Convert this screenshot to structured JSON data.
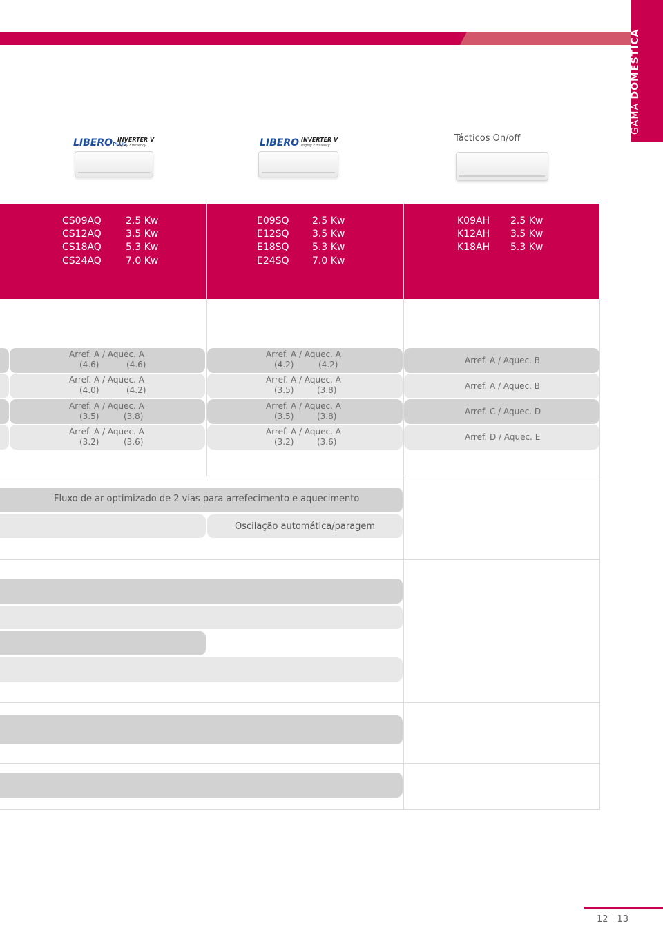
{
  "side_tab": {
    "prefix": "GAMA",
    "bold": "DOMÉSTICA"
  },
  "columns": [
    {
      "logo_brand": "LIBERO",
      "logo_plus": "PLUS",
      "logo_inverter": "INVERTER V",
      "logo_tagline": "Highly Efficiency",
      "models": [
        {
          "model": "CS09AQ",
          "power": "2.5 Kw"
        },
        {
          "model": "CS12AQ",
          "power": "3.5 Kw"
        },
        {
          "model": "CS18AQ",
          "power": "5.3 Kw"
        },
        {
          "model": "CS24AQ",
          "power": "7.0 Kw"
        }
      ],
      "energy": [
        {
          "line1": "Arref. A / Aquec. A",
          "line2a": "(4.6)",
          "line2b": "(4.6)"
        },
        {
          "line1": "Arref. A / Aquec. A",
          "line2a": "(4.0)",
          "line2b": "(4.2)"
        },
        {
          "line1": "Arref. A / Aquec. A",
          "line2a": "(3.5)",
          "line2b": "(3.8)"
        },
        {
          "line1": "Arref. A / Aquec. A",
          "line2a": "(3.2)",
          "line2b": "(3.6)"
        }
      ]
    },
    {
      "logo_brand": "LIBERO",
      "logo_inverter": "INVERTER V",
      "logo_tagline": "Highly Efficiency",
      "models": [
        {
          "model": "E09SQ",
          "power": "2.5 Kw"
        },
        {
          "model": "E12SQ",
          "power": "3.5 Kw"
        },
        {
          "model": "E18SQ",
          "power": "5.3 Kw"
        },
        {
          "model": "E24SQ",
          "power": "7.0 Kw"
        }
      ],
      "energy": [
        {
          "line1": "Arref. A / Aquec. A",
          "line2a": "(4.2)",
          "line2b": "(4.2)"
        },
        {
          "line1": "Arref. A / Aquec. A",
          "line2a": "(3.5)",
          "line2b": "(3.8)"
        },
        {
          "line1": "Arref. A / Aquec. A",
          "line2a": "(3.5)",
          "line2b": "(3.8)"
        },
        {
          "line1": "Arref. A / Aquec. A",
          "line2a": "(3.2)",
          "line2b": "(3.6)"
        }
      ]
    },
    {
      "title": "Tácticos On/off",
      "models": [
        {
          "model": "K09AH",
          "power": "2.5 Kw"
        },
        {
          "model": "K12AH",
          "power": "3.5 Kw"
        },
        {
          "model": "K18AH",
          "power": "5.3 Kw"
        }
      ],
      "energy": [
        {
          "line1": "Arref. A / Aquec. B"
        },
        {
          "line1": "Arref. A / Aquec. B"
        },
        {
          "line1": "Arref. C / Aquec. D"
        },
        {
          "line1": "Arref. D / Aquec. E"
        }
      ]
    }
  ],
  "features": {
    "airflow": "Fluxo de ar optimizado de 2 vias para arrefecimento e aquecimento",
    "oscillation": "Oscilação automática/paragem"
  },
  "page": {
    "left": "12",
    "right": "13"
  },
  "colors": {
    "brand_red": "#c8004e",
    "pill_dark": "#d2d2d2",
    "pill_light": "#e8e8e8"
  }
}
